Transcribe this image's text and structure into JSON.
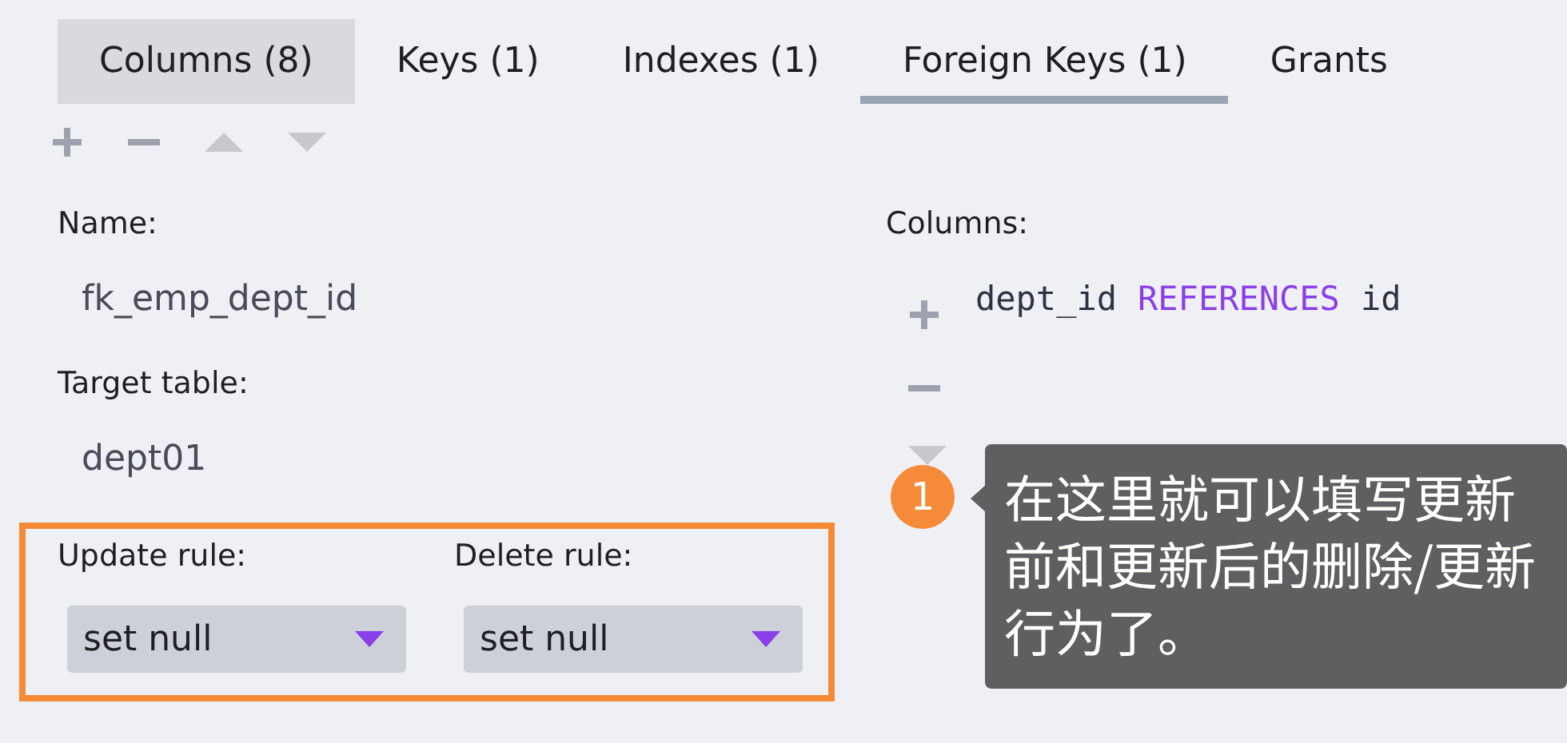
{
  "tabs": [
    {
      "label": "Columns (8)",
      "selected": false,
      "hovered": true
    },
    {
      "label": "Keys (1)",
      "selected": false,
      "hovered": false
    },
    {
      "label": "Indexes (1)",
      "selected": false,
      "hovered": false
    },
    {
      "label": "Foreign Keys (1)",
      "selected": true,
      "hovered": false
    },
    {
      "label": "Grants",
      "selected": false,
      "hovered": false
    }
  ],
  "toolbar": [
    {
      "kind": "add",
      "disabled": false
    },
    {
      "kind": "remove",
      "disabled": false
    },
    {
      "kind": "up",
      "disabled": true
    },
    {
      "kind": "down",
      "disabled": true
    }
  ],
  "form": {
    "name_label": "Name:",
    "name_value": "fk_emp_dept_id",
    "target_label": "Target table:",
    "target_value": "dept01",
    "rules": [
      {
        "label": "Update rule:",
        "value": "set null"
      },
      {
        "label": "Delete rule:",
        "value": "set null"
      }
    ]
  },
  "columns": {
    "label": "Columns:",
    "tools": [
      {
        "kind": "add",
        "disabled": false
      },
      {
        "kind": "remove",
        "disabled": false
      },
      {
        "kind": "down",
        "disabled": true
      }
    ],
    "rows": [
      {
        "column": "dept_id",
        "keyword": "REFERENCES",
        "target": "id"
      }
    ]
  },
  "annotation": {
    "number": "1",
    "text": "在这里就可以填写更新前和更新后的删除/更新行为了。"
  }
}
